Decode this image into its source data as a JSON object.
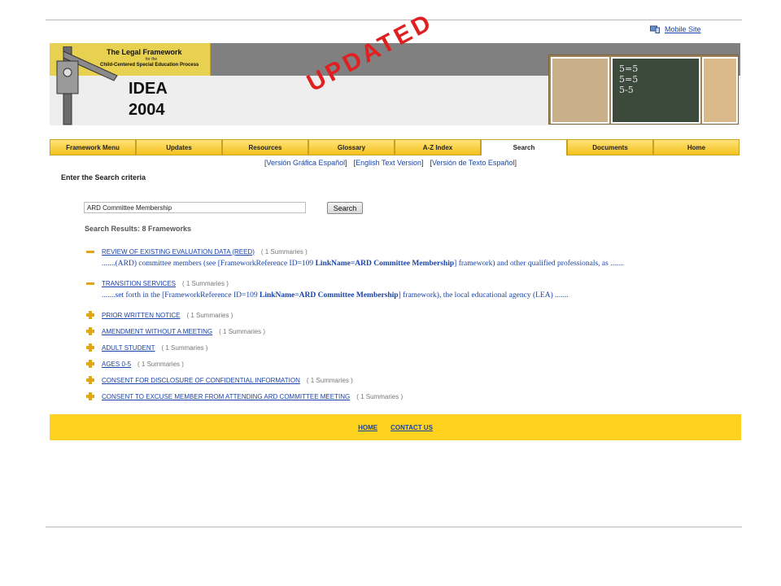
{
  "top_links": {
    "mobile_site": "Mobile Site"
  },
  "header": {
    "logo_title": "The Legal Framework",
    "logo_for": "for the",
    "logo_subtitle": "Child-Centered Special Education Process",
    "idea_line1": "IDEA",
    "idea_line2": "2004",
    "stamp": "UPDATED",
    "chalkboard": "5=5\n5=5\n5-5"
  },
  "nav": {
    "items": [
      {
        "label": "Framework Menu",
        "active": false
      },
      {
        "label": "Updates",
        "active": false
      },
      {
        "label": "Resources",
        "active": false
      },
      {
        "label": "Glossary",
        "active": false
      },
      {
        "label": "A-Z Index",
        "active": false
      },
      {
        "label": "Search",
        "active": true
      },
      {
        "label": "Documents",
        "active": false
      },
      {
        "label": "Home",
        "active": false
      }
    ]
  },
  "languages": {
    "grafica_espanol": "Versión Gráfica Español",
    "english_text": "English Text Version",
    "texto_espanol": "Versión de Texto Español"
  },
  "search": {
    "criteria_label": "Enter the Search criteria",
    "query_value": "ARD Committee Membership",
    "button_label": "Search",
    "results_count": "Search Results: 8 Frameworks"
  },
  "results": [
    {
      "title": "REVIEW OF EXISTING EVALUATION DATA (REED)",
      "summaries": "( 1 Summaries )",
      "expanded": true,
      "snippet_pre": ".......(ARD) committee members (see [FrameworkReference ID=109 ",
      "snippet_bold": "LinkName=ARD Committee Membership",
      "snippet_post": "] framework) and other qualified professionals, as ......."
    },
    {
      "title": "TRANSITION SERVICES",
      "summaries": "( 1 Summaries )",
      "expanded": true,
      "snippet_pre": ".......set forth in the [FrameworkReference ID=109 ",
      "snippet_bold": "LinkName=ARD Committee Membership",
      "snippet_post": "] framework), the local educational agency (LEA) ......."
    },
    {
      "title": "PRIOR WRITTEN NOTICE",
      "summaries": "( 1 Summaries )",
      "expanded": false
    },
    {
      "title": "AMENDMENT WITHOUT A MEETING",
      "summaries": "( 1 Summaries )",
      "expanded": false
    },
    {
      "title": "ADULT STUDENT",
      "summaries": "( 1 Summaries )",
      "expanded": false
    },
    {
      "title": "AGES 0-5",
      "summaries": "( 1 Summaries )",
      "expanded": false
    },
    {
      "title": "CONSENT FOR DISCLOSURE OF CONFIDENTIAL INFORMATION",
      "summaries": "( 1 Summaries )",
      "expanded": false
    },
    {
      "title": "CONSENT TO EXCUSE MEMBER FROM ATTENDING ARD COMMITTEE MEETING",
      "summaries": "( 1 Summaries )",
      "expanded": false
    }
  ],
  "footer": {
    "home": "HOME",
    "contact": "CONTACT US"
  },
  "colors": {
    "nav_gold": "#f4c21c",
    "footer_gold": "#ffd21f",
    "link_blue": "#1a44a8",
    "stamp_red": "#e02020"
  }
}
